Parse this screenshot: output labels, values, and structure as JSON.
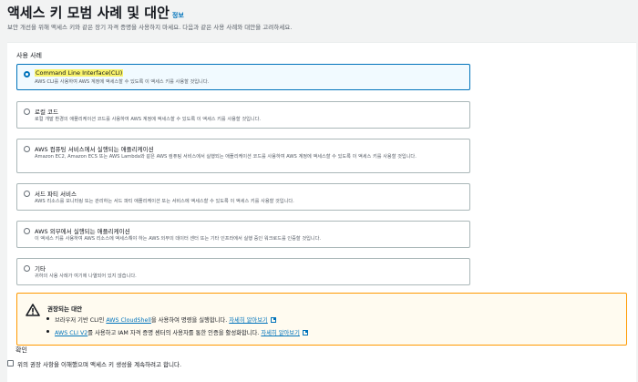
{
  "page": {
    "title": "액세스 키 모범 사례 및 대안",
    "info_link": "정보",
    "subtitle": "보안 개선을 위해 액세스 키와 같은 장기 자격 증명을 사용하지 마세요. 다음과 같은 사용 사례와 대안을 고려하세요."
  },
  "use_case": {
    "label": "사용 사례",
    "selected": "Command Line Interface(CLI)",
    "options": [
      {
        "title": "Command Line Interface(CLI)",
        "desc": "AWS CLI를 사용하여 AWS 계정에 액세스할 수 있도록 이 액세스 키를 사용할 것입니다."
      },
      {
        "title": "로컬 코드",
        "desc": "로컬 개발 환경의 애플리케이션 코드를 사용하여 AWS 계정에 액세스할 수 있도록 이 액세스 키를 사용할 것입니다."
      },
      {
        "title": "AWS 컴퓨팅 서비스에서 실행되는 애플리케이션",
        "desc": "Amazon EC2, Amazon ECS 또는 AWS Lambda와 같은 AWS 컴퓨팅 서비스에서 실행되는 애플리케이션 코드를 사용하여 AWS 계정에 액세스할 수 있도록 이 액세스 키를 사용할 것입니다."
      },
      {
        "title": "서드 파티 서비스",
        "desc": "AWS 리소스를 모니터링 또는 관리하는 서드 파티 애플리케이션 또는 서비스에 액세스할 수 있도록 이 액세스 키를 사용할 것입니다."
      },
      {
        "title": "AWS 외부에서 실행되는 애플리케이션",
        "desc": "이 액세스 키를 사용하여 AWS 리소스에 액세스해야 하는 AWS 외부의 데이터 센터 또는 기타 인프라에서 실행 중인 워크로드를 인증할 것입니다."
      },
      {
        "title": "기타",
        "desc": "귀하의 사용 사례가 여기에 나열되어 있지 않습니다."
      }
    ]
  },
  "alert": {
    "title": "권장되는 대안",
    "item1_pre": "브라우저 기반 CLI인",
    "item1_link": "AWS CloudShell",
    "item1_post": "을 사용하여 명령을 실행합니다.",
    "item1_more": "자세히 알아보기",
    "item2_link": "AWS CLI V2",
    "item2_post": "를 사용하고 IAM 자격 증명 센터의 사용자를 통한 인증을 활성화합니다.",
    "item2_more": "자세히 알아보기"
  },
  "confirm": {
    "label": "확인",
    "checkbox_text": "위의 권장 사항을 이해했으며 액세스 키 생성을 계속하려고 합니다."
  },
  "colors": {
    "accent": "#0073bb",
    "warning": "#ff9900",
    "highlight": "#f9f36b"
  }
}
